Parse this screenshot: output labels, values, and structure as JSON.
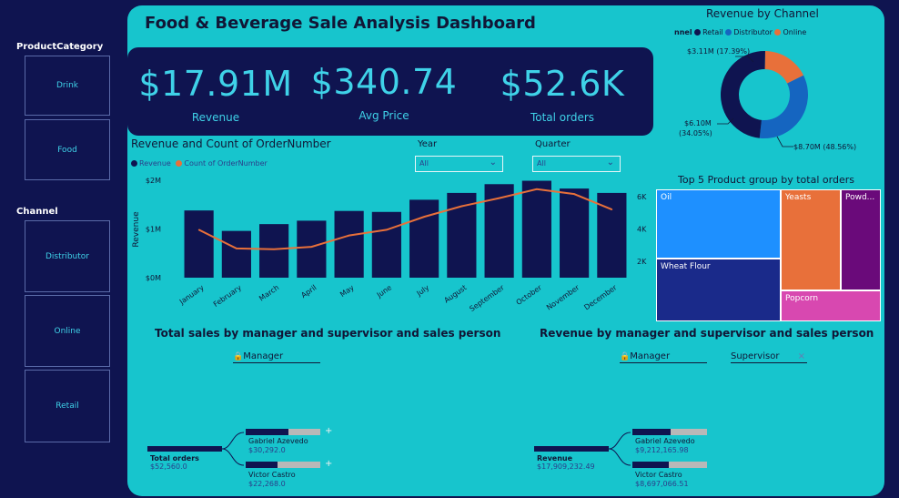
{
  "slicers": {
    "product_category": {
      "title": "ProductCategory",
      "items": [
        "Drink",
        "Food"
      ]
    },
    "channel": {
      "title": "Channel",
      "items": [
        "Distributor",
        "Online",
        "Retail"
      ]
    }
  },
  "dashboard_title": "Food & Beverage Sale Analysis Dashboard",
  "kpis": [
    {
      "value": "$17.91M",
      "label": "Revenue"
    },
    {
      "value": "$340.74",
      "label": "Avg Price"
    },
    {
      "value": "$52.6K",
      "label": "Total orders"
    }
  ],
  "revenue_by_channel": {
    "title": "Revenue by Channel",
    "legend_label": "nnel",
    "legend": [
      "Retail",
      "Distributor",
      "Online"
    ],
    "slice_labels": [
      "$3.11M (17.39%)",
      "$6.10M",
      "(34.05%)",
      "$8.70M (48.56%)"
    ],
    "colors": {
      "retail": "#0f1450",
      "distributor": "#1565c0",
      "online": "#e8703a"
    }
  },
  "combo_chart": {
    "title": "Revenue and Count of OrderNumber",
    "legend": [
      "Revenue",
      "Count of OrderNumber"
    ],
    "ylabel": "Revenue",
    "y_ticks": [
      "$2M",
      "$1M",
      "$0M"
    ],
    "y2_ticks": [
      "6K",
      "4K",
      "2K"
    ]
  },
  "filters": {
    "year": {
      "label": "Year",
      "value": "All"
    },
    "quarter": {
      "label": "Quarter",
      "value": "All"
    }
  },
  "treemap": {
    "title": "Top 5 Product group by total orders",
    "cells": [
      "Oil",
      "Wheat Flour",
      "Yeasts",
      "Powd...",
      "Popcorn"
    ]
  },
  "tree_left": {
    "title": "Total sales by manager and supervisor and sales person",
    "field": "Manager",
    "root_label": "Total orders",
    "root_value": "$52,560.0",
    "children": [
      {
        "name": "Gabriel Azevedo",
        "value": "$30,292.0"
      },
      {
        "name": "Victor Castro",
        "value": "$22,268.0"
      }
    ],
    "expand_symbol": "+"
  },
  "tree_right": {
    "title": "Revenue by manager and supervisor and sales person",
    "field": "Manager",
    "field2": "Supervisor",
    "remove_symbol": "×",
    "root_label": "Revenue",
    "root_value": "$17,909,232.49",
    "children": [
      {
        "name": "Gabriel Azevedo",
        "value": "$9,212,165.98"
      },
      {
        "name": "Victor Castro",
        "value": "$8,697,066.51"
      }
    ]
  },
  "chart_data": [
    {
      "type": "bar",
      "title": "Revenue and Count of OrderNumber",
      "categories": [
        "January",
        "February",
        "March",
        "April",
        "May",
        "June",
        "July",
        "August",
        "September",
        "October",
        "November",
        "December"
      ],
      "series": [
        {
          "name": "Revenue",
          "type": "bar",
          "axis": "left",
          "values": [
            1380000,
            960000,
            1100000,
            1170000,
            1370000,
            1350000,
            1600000,
            1740000,
            1920000,
            1990000,
            1830000,
            1740000
          ]
        },
        {
          "name": "Count of OrderNumber",
          "type": "line",
          "axis": "right",
          "values": [
            3950,
            2800,
            2750,
            2900,
            3600,
            3950,
            4750,
            5400,
            5900,
            6450,
            6150,
            5200
          ]
        }
      ],
      "ylabel": "Revenue",
      "ylim": [
        0,
        2000000
      ],
      "y2lim": [
        1000,
        7000
      ],
      "colors": {
        "Revenue": "#0f1450",
        "Count of OrderNumber": "#e8703a"
      },
      "grid": false,
      "legend": "top-left"
    },
    {
      "type": "pie",
      "title": "Revenue by Channel",
      "categories": [
        "Online",
        "Distributor",
        "Retail"
      ],
      "values": [
        3110000,
        6100000,
        8700000
      ],
      "percent": [
        17.39,
        34.05,
        48.56
      ],
      "colors": {
        "Online": "#e8703a",
        "Distributor": "#1565c0",
        "Retail": "#0f1450"
      }
    },
    {
      "type": "heatmap",
      "title": "Top 5 Product group by total orders",
      "categories": [
        "Oil",
        "Wheat Flour",
        "Yeasts",
        "Powd...",
        "Popcorn"
      ],
      "colors": {
        "Oil": "#1e90ff",
        "Wheat Flour": "#1a2a8a",
        "Yeasts": "#e8703a",
        "Powd...": "#6a0a7a",
        "Popcorn": "#d848b0"
      }
    }
  ]
}
